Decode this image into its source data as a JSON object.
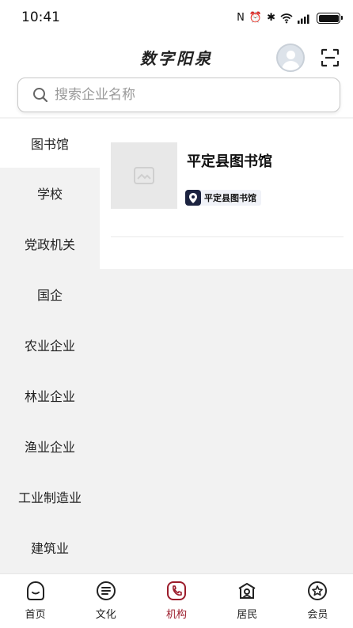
{
  "status_bar": {
    "time": "10:41"
  },
  "header": {
    "title": "数字阳泉"
  },
  "search": {
    "placeholder": "搜索企业名称"
  },
  "sidebar": {
    "items": [
      {
        "label": "图书馆",
        "active": true
      },
      {
        "label": "学校"
      },
      {
        "label": "党政机关"
      },
      {
        "label": "国企"
      },
      {
        "label": "农业企业"
      },
      {
        "label": "林业企业"
      },
      {
        "label": "渔业企业"
      },
      {
        "label": "工业制造业"
      },
      {
        "label": "建筑业"
      }
    ]
  },
  "content": {
    "cards": [
      {
        "title": "平定县图书馆",
        "tag": "平定县图书馆"
      }
    ]
  },
  "bottom_nav": {
    "items": [
      {
        "label": "首页",
        "icon": "home-icon"
      },
      {
        "label": "文化",
        "icon": "culture-icon"
      },
      {
        "label": "机构",
        "icon": "institution-icon",
        "active": true
      },
      {
        "label": "居民",
        "icon": "resident-icon"
      },
      {
        "label": "会员",
        "icon": "member-icon"
      }
    ]
  },
  "colors": {
    "accent": "#9b1b2a",
    "tag_icon_bg": "#1c2340"
  }
}
